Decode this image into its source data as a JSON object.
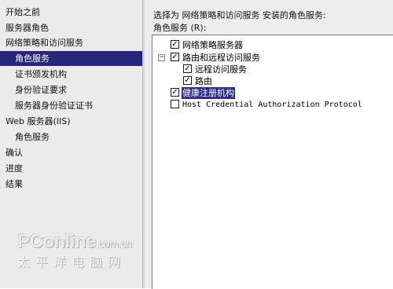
{
  "sidebar": {
    "items": [
      {
        "label": "开始之前",
        "selected": false
      },
      {
        "label": "服务器角色",
        "selected": false
      },
      {
        "label": "网络策略和访问服务",
        "selected": false
      },
      {
        "label": "角色服务",
        "selected": true
      },
      {
        "label": "证书颁发机构",
        "selected": false
      },
      {
        "label": "身份验证要求",
        "selected": false
      },
      {
        "label": "服务器身份验证证书",
        "selected": false
      },
      {
        "label": "Web 服务器(IIS)",
        "selected": false
      },
      {
        "label": "角色服务",
        "selected": false
      },
      {
        "label": "确认",
        "selected": false
      },
      {
        "label": "进度",
        "selected": false
      },
      {
        "label": "结果",
        "selected": false
      }
    ]
  },
  "main": {
    "instruction": "选择为 网络策略和访问服务 安装的角色服务:",
    "list_label": "角色服务 (R):",
    "role_services": [
      {
        "label": "网络策略服务器",
        "checked": true
      },
      {
        "label": "路由和远程访问服务",
        "checked": true,
        "expanded": true
      },
      {
        "label": "远程访问服务",
        "checked": true
      },
      {
        "label": "路由",
        "checked": true
      },
      {
        "label": "健康注册机构",
        "checked": true,
        "highlighted": true
      },
      {
        "label": "Host Credential Authorization Protocol",
        "checked": false
      }
    ],
    "tree_toggle": "−"
  },
  "watermark": {
    "brand": "PConline",
    "domain": ".com.cn",
    "tagline": "太平洋电脑网"
  },
  "colors": {
    "selection": "#25267c",
    "sidebar_bg": "#ebebeb",
    "main_bg": "#ededed"
  }
}
